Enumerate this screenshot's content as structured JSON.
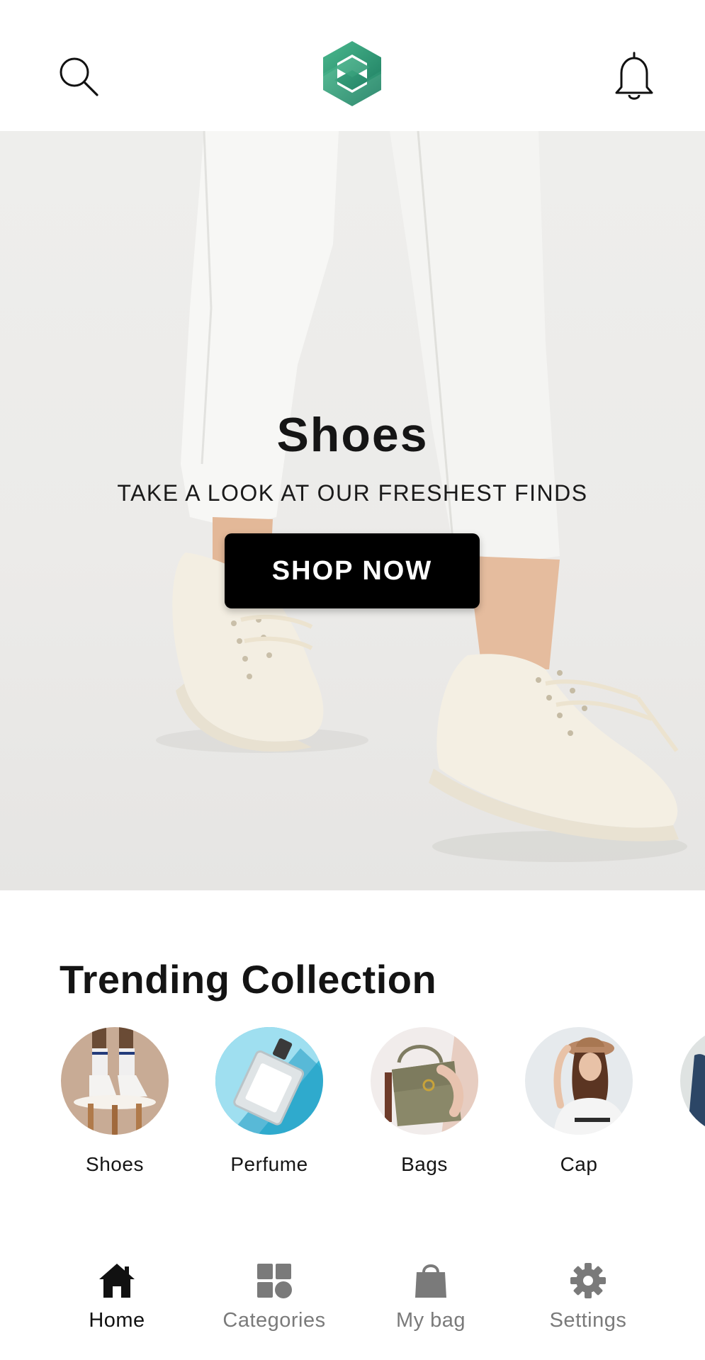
{
  "header": {
    "search_icon": "search-icon",
    "logo_icon": "brand-logo",
    "bell_icon": "bell-icon",
    "brand_color": "#2e9b78"
  },
  "hero": {
    "title": "Shoes",
    "subtitle": "TAKE A LOOK AT OUR FRESHEST FINDS",
    "cta_label": "SHOP NOW"
  },
  "trending": {
    "title": "Trending Collection",
    "items": [
      {
        "label": "Shoes"
      },
      {
        "label": "Perfume"
      },
      {
        "label": "Bags"
      },
      {
        "label": "Cap"
      },
      {
        "label": ""
      }
    ]
  },
  "nav": {
    "items": [
      {
        "label": "Home",
        "icon": "home-icon",
        "active": true
      },
      {
        "label": "Categories",
        "icon": "grid-icon",
        "active": false
      },
      {
        "label": "My bag",
        "icon": "shopping-bag-icon",
        "active": false
      },
      {
        "label": "Settings",
        "icon": "gear-icon",
        "active": false
      }
    ],
    "active_color": "#111111",
    "inactive_color": "#7a7a7a"
  }
}
